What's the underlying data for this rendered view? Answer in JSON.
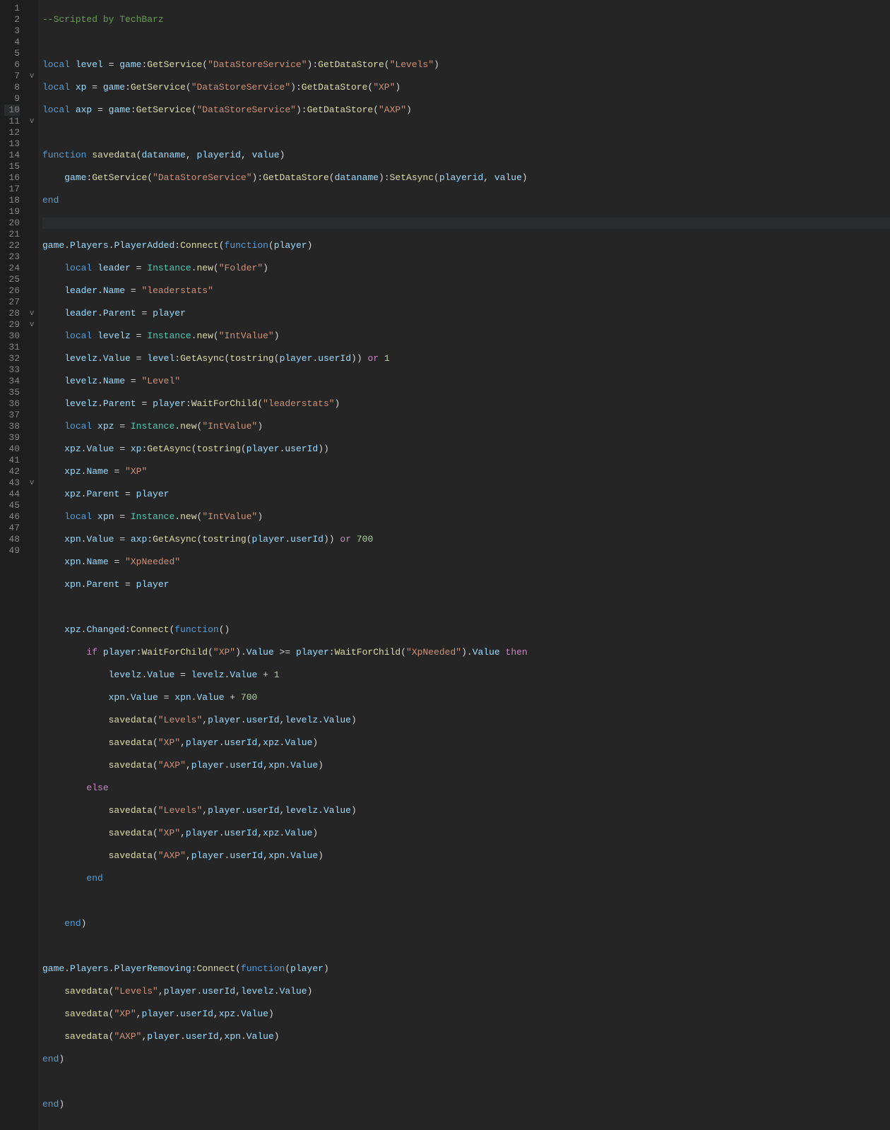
{
  "gutter": {
    "lines": [
      "1",
      "2",
      "3",
      "4",
      "5",
      "6",
      "7",
      "8",
      "9",
      "10",
      "11",
      "12",
      "13",
      "14",
      "15",
      "16",
      "17",
      "18",
      "19",
      "20",
      "21",
      "22",
      "23",
      "24",
      "25",
      "26",
      "27",
      "28",
      "29",
      "30",
      "31",
      "32",
      "33",
      "34",
      "35",
      "36",
      "37",
      "38",
      "39",
      "40",
      "41",
      "42",
      "43",
      "44",
      "45",
      "46",
      "47",
      "48",
      "49"
    ],
    "highlight_line": 10
  },
  "folds": [
    "",
    "",
    "",
    "",
    "",
    "",
    "v",
    "",
    "",
    "",
    "v",
    "",
    "",
    "",
    "",
    "",
    "",
    "",
    "",
    "",
    "",
    "",
    "",
    "",
    "",
    "",
    "",
    "v",
    "v",
    "",
    "",
    "",
    "",
    "",
    "",
    "",
    "",
    "",
    "",
    "",
    "",
    "",
    "v",
    "",
    "",
    "",
    "",
    "",
    ""
  ],
  "tokens": {
    "comment1": "--Scripted by TechBarz",
    "local": "local",
    "function": "function",
    "end": "end",
    "if": "if",
    "then": "then",
    "else": "else",
    "or": "or",
    "level": "level",
    "xp": "xp",
    "axp": "axp",
    "game": "game",
    "GetService": "GetService",
    "GetDataStore": "GetDataStore",
    "SetAsync": "SetAsync",
    "GetAsync": "GetAsync",
    "savedata": "savedata",
    "dataname": "dataname",
    "playerid": "playerid",
    "value": "value",
    "Players": "Players",
    "PlayerAdded": "PlayerAdded",
    "PlayerRemoving": "PlayerRemoving",
    "Connect": "Connect",
    "player": "player",
    "leader": "leader",
    "Instance": "Instance",
    "new": "new",
    "Name": "Name",
    "Parent": "Parent",
    "Value": "Value",
    "levelz": "levelz",
    "xpz": "xpz",
    "xpn": "xpn",
    "WaitForChild": "WaitForChild",
    "tostring": "tostring",
    "userId": "userId",
    "Changed": "Changed",
    "eq": " = ",
    "ge": " >= ",
    "plus": " + ",
    "dot": ".",
    "colon": ":",
    "comma": ",",
    "lp": "(",
    "rp": ")",
    "s_DataStoreService": "\"DataStoreService\"",
    "s_Levels": "\"Levels\"",
    "s_XP": "\"XP\"",
    "s_AXP": "\"AXP\"",
    "s_Folder": "\"Folder\"",
    "s_leaderstats": "\"leaderstats\"",
    "s_IntValue": "\"IntValue\"",
    "s_Level": "\"Level\"",
    "s_XpNeeded": "\"XpNeeded\"",
    "n1": "1",
    "n700": "700"
  }
}
